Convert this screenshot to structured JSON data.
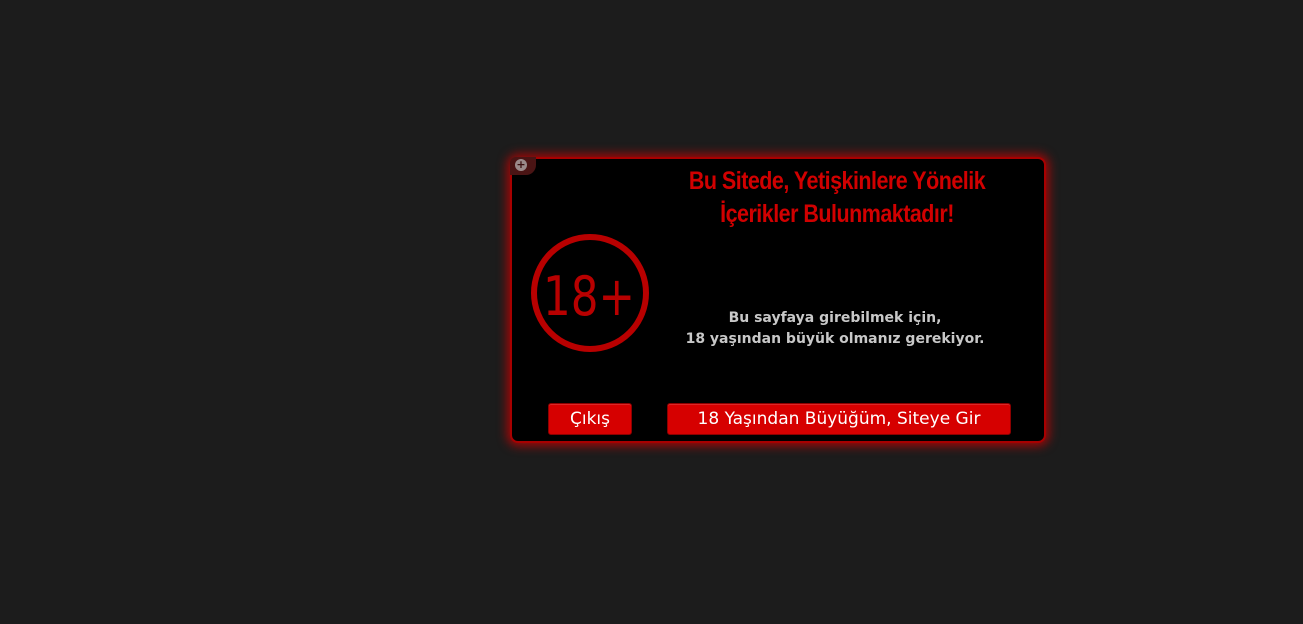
{
  "modal": {
    "title_line1": "Bu Sitede, Yetişkinlere Yönelik",
    "title_line2": "İçerikler Bulunmaktadır!",
    "badge_text": "18+",
    "message_line1": "Bu sayfaya girebilmek için,",
    "message_line2": "18 yaşından büyük olmanız gerekiyor.",
    "exit_label": "Çıkış",
    "enter_label": "18 Yaşından Büyüğüm, Siteye Gir"
  },
  "colors": {
    "page_background": "#1c1c1c",
    "modal_background": "#000000",
    "accent_red": "#d60000",
    "title_red": "#d10000",
    "badge_red": "#b80000",
    "message_text": "#c8c8c8"
  },
  "icons": {
    "corner": "plus-circle-icon"
  }
}
